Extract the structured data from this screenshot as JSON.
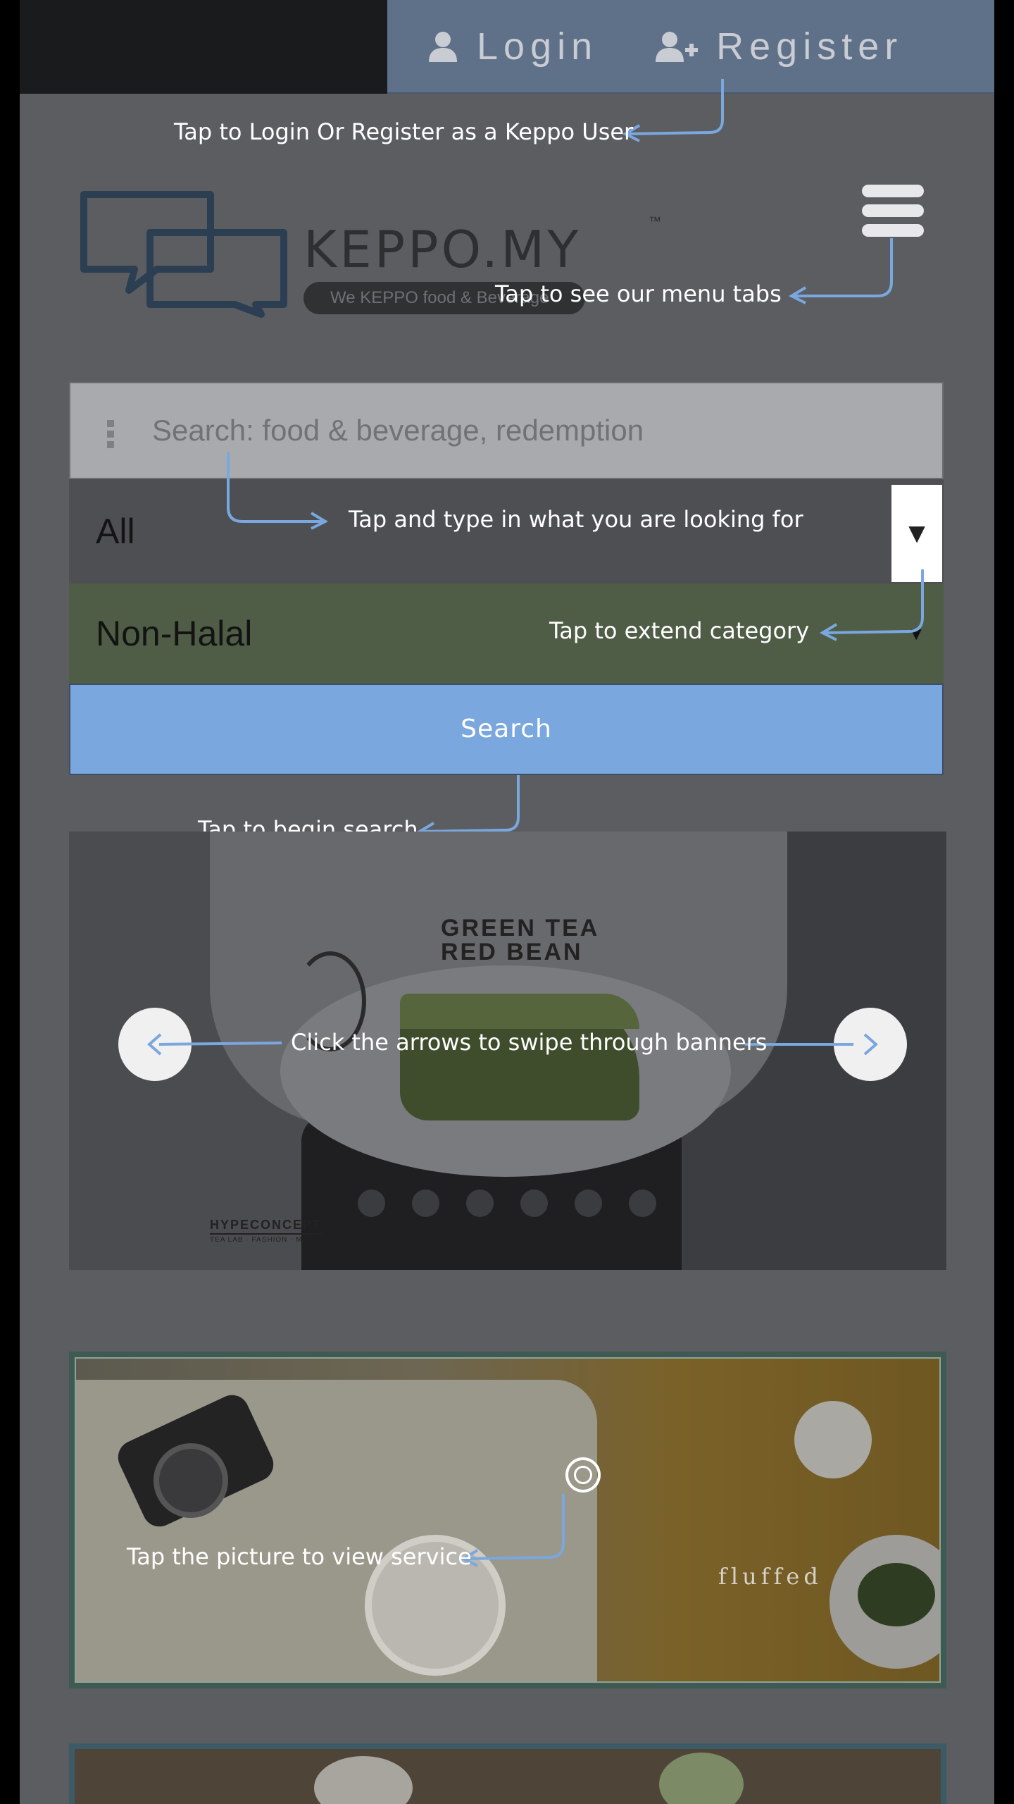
{
  "topbar": {
    "login_label": "Login",
    "register_label": "Register"
  },
  "logo": {
    "wordmark": "KEPPO.MY",
    "trademark": "™",
    "tagline": "We KEPPO food & Beverage"
  },
  "search": {
    "placeholder": "Search: food & beverage, redemption",
    "category_value": "All",
    "category_toggle": "▼",
    "halal_value": "Non-Halal",
    "halal_caret": "▼",
    "button_label": "Search"
  },
  "banner": {
    "title_line1": "GREEN TEA",
    "title_line2": "RED BEAN",
    "brand": "HYPECONCEPT",
    "brand_sub": "TEA LAB · FASHION · MUSIC",
    "slide_count": 6
  },
  "service": {
    "brand_text": "fluffed"
  },
  "hints": {
    "login": "Tap to Login Or Register as a Keppo User",
    "menu": "Tap to see our menu tabs",
    "search_input": "Tap and type in what you are looking for",
    "category": "Tap to extend category",
    "begin_search": "Tap to begin search",
    "arrows": "Click the arrows to swipe through banners",
    "service": "Tap the picture to view service"
  },
  "colors": {
    "overlay": "#5b5d61",
    "accent_arrow": "#7aa7de",
    "search_button": "#7aa7de",
    "topbar_right": "#5f7089"
  },
  "icons": {
    "login": "user-icon",
    "register": "user-plus-icon",
    "menu": "hamburger-icon",
    "prev": "chevron-left-icon",
    "next": "chevron-right-icon"
  }
}
